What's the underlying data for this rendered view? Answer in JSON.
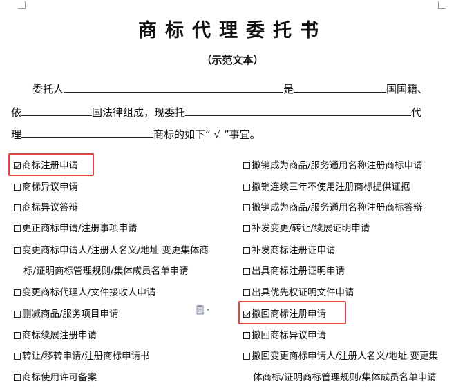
{
  "document": {
    "title": "商标代理委托书",
    "subtitle": "（示范文本）",
    "lines": [
      {
        "a": "委托人",
        "b": "是",
        "c": "国国籍、"
      },
      {
        "a": "依",
        "b": "国法律组成，现委托",
        "c": "代"
      },
      {
        "a": "理",
        "b": "商标的如下“ √ ”事宜。"
      }
    ]
  },
  "left_items": [
    {
      "label": "商标注册申请",
      "checked": true
    },
    {
      "label": "商标异议申请",
      "checked": false
    },
    {
      "label": "商标异议答辩",
      "checked": false
    },
    {
      "label": "更正商标申请/注册事项申请",
      "checked": false
    },
    {
      "label": "变更商标申请人/注册人名义/地址  变更集体商",
      "checked": false
    },
    {
      "label": "标/证明商标管理规则/集体成员名单申请",
      "checked": null
    },
    {
      "label": "变更商标代理人/文件接收人申请",
      "checked": false
    },
    {
      "label": "删减商品/服务项目申请",
      "checked": false
    },
    {
      "label": "商标续展注册申请",
      "checked": false
    },
    {
      "label": "转让/移转申请/注册商标申请书",
      "checked": false
    },
    {
      "label": "商标使用许可备案",
      "checked": false
    }
  ],
  "right_items": [
    {
      "label": "撤销成为商品/服务通用名称注册商标申请",
      "checked": false
    },
    {
      "label": "撤销连续三年不使用注册商标提供证据",
      "checked": false
    },
    {
      "label": "撤销成为商品/服务通用名称注册商标答辩",
      "checked": false
    },
    {
      "label": "补发变更/转让/续展证明申请",
      "checked": false
    },
    {
      "label": "补发商标注册证申请",
      "checked": false
    },
    {
      "label": "出具商标注册证明申请",
      "checked": false
    },
    {
      "label": "出具优先权证明文件申请",
      "checked": false
    },
    {
      "label": "撤回商标注册申请",
      "checked": true
    },
    {
      "label": "撤回商标异议申请",
      "checked": false
    },
    {
      "label": "撤回变更商标申请人/注册人名义/地址  变更集",
      "checked": false
    },
    {
      "label": "体商标/证明商标管理规则/集体成员名单申请",
      "checked": null
    }
  ],
  "icons": {
    "paste": "paste-options-icon"
  },
  "colors": {
    "highlight": "#e0443e"
  }
}
